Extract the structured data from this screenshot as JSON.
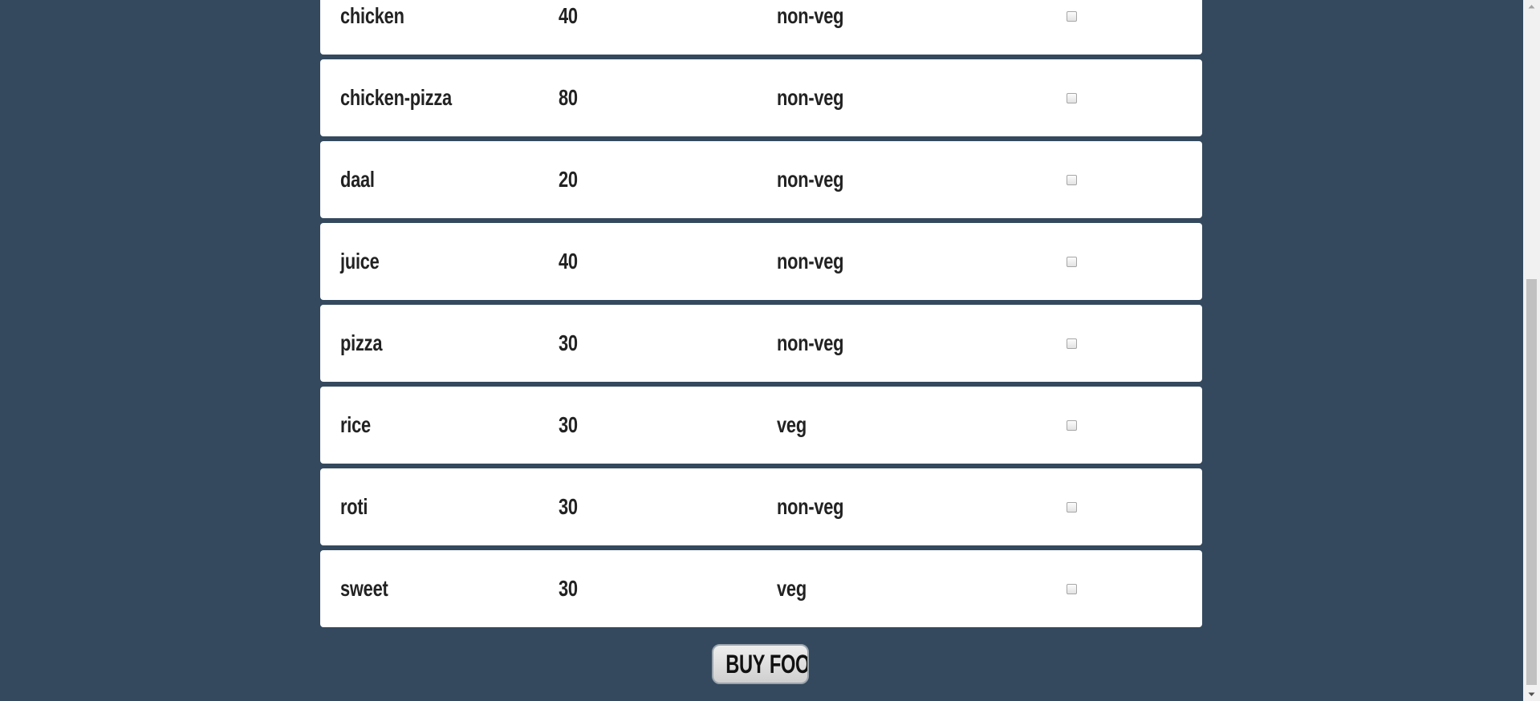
{
  "food_items": [
    {
      "name": "chicken",
      "price": "40",
      "type": "non-veg",
      "checked": false
    },
    {
      "name": "chicken-pizza",
      "price": "80",
      "type": "non-veg",
      "checked": false
    },
    {
      "name": "daal",
      "price": "20",
      "type": "non-veg",
      "checked": false
    },
    {
      "name": "juice",
      "price": "40",
      "type": "non-veg",
      "checked": false
    },
    {
      "name": "pizza",
      "price": "30",
      "type": "non-veg",
      "checked": false
    },
    {
      "name": "rice",
      "price": "30",
      "type": "veg",
      "checked": false
    },
    {
      "name": "roti",
      "price": "30",
      "type": "non-veg",
      "checked": false
    },
    {
      "name": "sweet",
      "price": "30",
      "type": "veg",
      "checked": false
    }
  ],
  "buy_button_label": "BUY FOOD",
  "colors": {
    "background": "#34495e",
    "card": "#ffffff",
    "text": "#222222",
    "scrollbar_track": "#f1f1f1",
    "scrollbar_thumb": "#c1c1c1"
  },
  "icons": [
    "scroll-up-arrow-icon",
    "scroll-down-arrow-icon"
  ]
}
